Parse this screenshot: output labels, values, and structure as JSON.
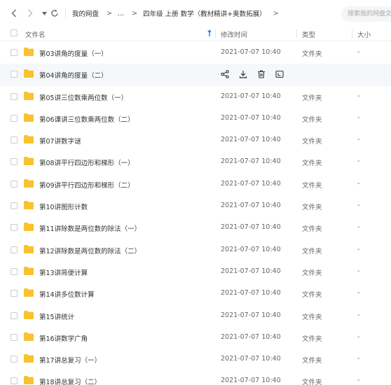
{
  "nav": {
    "home_label": "我的网盘",
    "ellipsis_label": "...",
    "folder_label": "四年级 上册 数学（教材精讲+奥数拓展）",
    "separator": ">",
    "search_placeholder": "搜索我的网盘文件"
  },
  "columns": {
    "name": "文件名",
    "modified": "修改时间",
    "type": "类型",
    "size": "大小"
  },
  "colors": {
    "folder": "#f9c22e",
    "accent": "#2e8cf0"
  },
  "icons": {
    "hover_actions": [
      "share-icon",
      "download-icon",
      "delete-icon",
      "more-icon"
    ]
  },
  "rows": [
    {
      "name": "第03讲角的度量（一）",
      "time": "2021-07-07 10:40",
      "type": "文件夹",
      "size": "-"
    },
    {
      "name": "第04讲角的度量（二）",
      "time": "",
      "type": "",
      "size": ""
    },
    {
      "name": "第05讲三位数乘两位数（一）",
      "time": "2021-07-07 10:40",
      "type": "文件夹",
      "size": "-"
    },
    {
      "name": "第06课讲三位数乘两位数（二）",
      "time": "2021-07-07 10:40",
      "type": "文件夹",
      "size": "-"
    },
    {
      "name": "第07讲数字谜",
      "time": "2021-07-07 10:40",
      "type": "文件夹",
      "size": "-"
    },
    {
      "name": "第08讲平行四边形和梯形（一）",
      "time": "2021-07-07 10:40",
      "type": "文件夹",
      "size": "-"
    },
    {
      "name": "第09讲平行四边形和梯形（二）",
      "time": "2021-07-07 10:40",
      "type": "文件夹",
      "size": "-"
    },
    {
      "name": "第10讲图形计数",
      "time": "2021-07-07 10:40",
      "type": "文件夹",
      "size": "-"
    },
    {
      "name": "第11讲除数是两位数的除法（一）",
      "time": "2021-07-07 10:40",
      "type": "文件夹",
      "size": "-"
    },
    {
      "name": "第12讲除数是两位数的除法（二）",
      "time": "2021-07-07 10:40",
      "type": "文件夹",
      "size": "-"
    },
    {
      "name": "第13讲简便计算",
      "time": "2021-07-07 10:40",
      "type": "文件夹",
      "size": "-"
    },
    {
      "name": "第14讲多位数计算",
      "time": "2021-07-07 10:40",
      "type": "文件夹",
      "size": "-"
    },
    {
      "name": "第15讲统计",
      "time": "2021-07-07 10:40",
      "type": "文件夹",
      "size": "-"
    },
    {
      "name": "第16讲数学广角",
      "time": "2021-07-07 10:40",
      "type": "文件夹",
      "size": "-"
    },
    {
      "name": "第17讲总复习（一）",
      "time": "2021-07-07 10:40",
      "type": "文件夹",
      "size": "-"
    },
    {
      "name": "第18讲总复习（二）",
      "time": "2021-07-07 10:40",
      "type": "文件夹",
      "size": "-"
    }
  ]
}
